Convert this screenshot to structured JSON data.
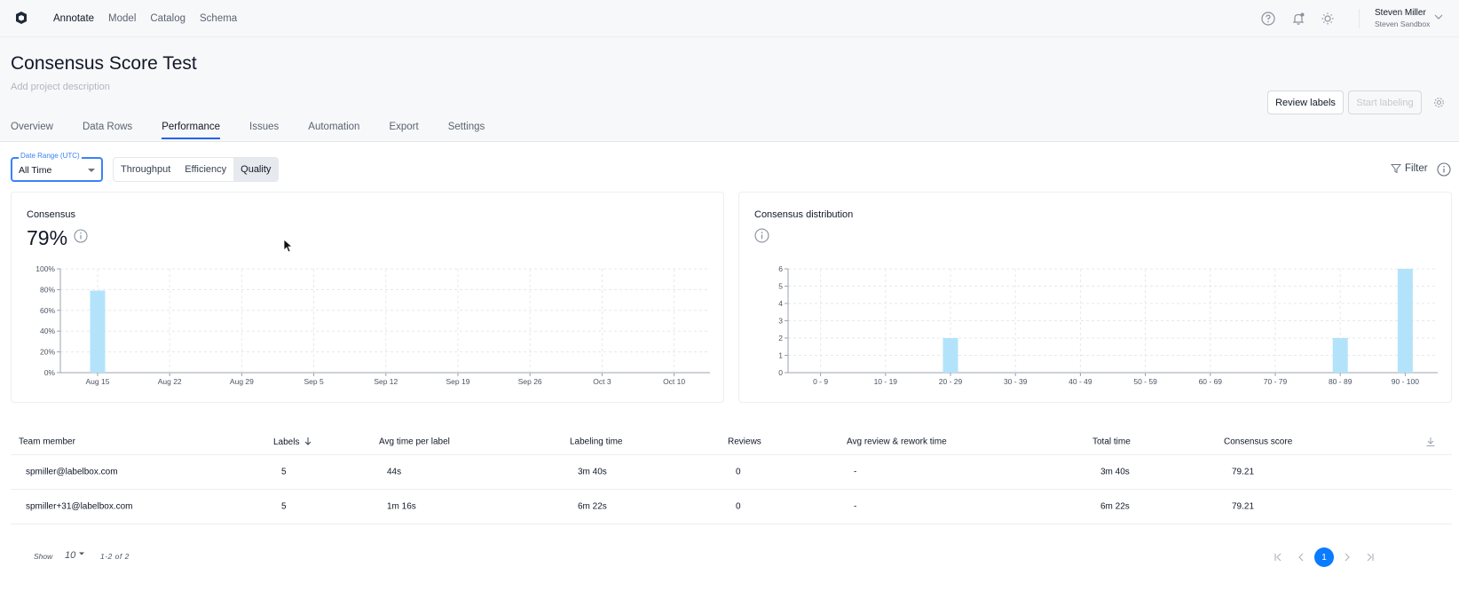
{
  "topbar": {
    "nav": [
      "Annotate",
      "Model",
      "Catalog",
      "Schema"
    ],
    "user_name": "Steven Miller",
    "user_org": "Steven Sandbox"
  },
  "header": {
    "title": "Consensus Score Test",
    "description_placeholder": "Add project description",
    "review_button": "Review labels",
    "start_button": "Start labeling",
    "tabs": [
      "Overview",
      "Data Rows",
      "Performance",
      "Issues",
      "Automation",
      "Export",
      "Settings"
    ],
    "active_tab": "Performance"
  },
  "filters": {
    "date_range_label": "Date Range (UTC)",
    "date_range_value": "All Time",
    "segments": [
      "Throughput",
      "Efficiency",
      "Quality"
    ],
    "active_segment": "Quality",
    "filter_label": "Filter"
  },
  "consensus_card": {
    "title": "Consensus",
    "value": "79%"
  },
  "distribution_card": {
    "title": "Consensus distribution"
  },
  "chart_data": [
    {
      "type": "bar",
      "title": "Consensus",
      "categories": [
        "Aug 15",
        "Aug 22",
        "Aug 29",
        "Sep 5",
        "Sep 12",
        "Sep 19",
        "Sep 26",
        "Oct 3",
        "Oct 10"
      ],
      "values": [
        79,
        0,
        0,
        0,
        0,
        0,
        0,
        0,
        0
      ],
      "y_ticks": [
        "0%",
        "20%",
        "40%",
        "60%",
        "80%",
        "100%"
      ],
      "ylim": [
        0,
        100
      ],
      "grid": true,
      "color": "#b3e3fb"
    },
    {
      "type": "bar",
      "title": "Consensus distribution",
      "categories": [
        "0 - 9",
        "10 - 19",
        "20 - 29",
        "30 - 39",
        "40 - 49",
        "50 - 59",
        "60 - 69",
        "70 - 79",
        "80 - 89",
        "90 - 100"
      ],
      "values": [
        0,
        0,
        2,
        0,
        0,
        0,
        0,
        0,
        2,
        6
      ],
      "y_ticks": [
        "0",
        "1",
        "2",
        "3",
        "4",
        "5",
        "6"
      ],
      "ylim": [
        0,
        6
      ],
      "grid": true,
      "color": "#b3e3fb"
    }
  ],
  "table": {
    "headers": [
      "Team member",
      "Labels",
      "Avg time per label",
      "Labeling time",
      "Reviews",
      "Avg review & rework time",
      "Total time",
      "Consensus score"
    ],
    "rows": [
      [
        "spmiller@labelbox.com",
        "5",
        "44s",
        "3m 40s",
        "0",
        "-",
        "3m 40s",
        "79.21"
      ],
      [
        "spmiller+31@labelbox.com",
        "5",
        "1m 16s",
        "6m 22s",
        "0",
        "-",
        "6m 22s",
        "79.21"
      ]
    ]
  },
  "pagination": {
    "show_label": "Show",
    "page_size": "10",
    "range": "1-2 of 2",
    "current_page": "1"
  },
  "colors": {
    "accent": "#2563eb",
    "page_active": "#0b7bff",
    "bar": "#b3e3fb"
  }
}
